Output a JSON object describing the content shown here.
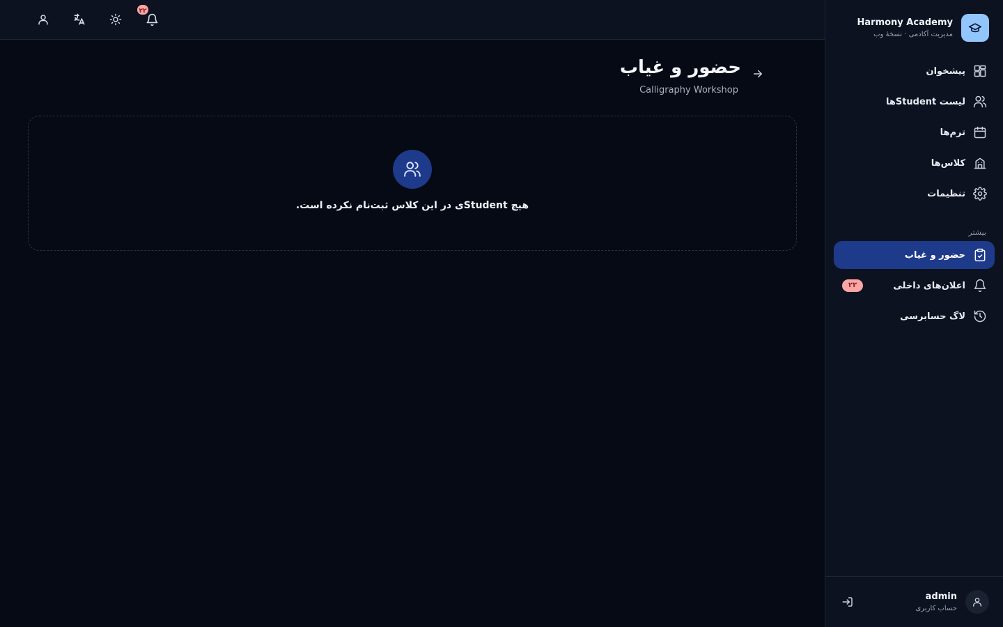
{
  "brand": {
    "name": "Harmony Academy",
    "subtitle": "مدیریت آکادمی · نسخهٔ وب",
    "logo_icon": "graduation-cap-icon"
  },
  "nav": {
    "main_items": [
      {
        "label": "پیشخوان",
        "icon": "dashboard-icon"
      },
      {
        "label": "لیست Studentها",
        "icon": "users-icon"
      },
      {
        "label": "ترم‌ها",
        "icon": "calendar-icon"
      },
      {
        "label": "کلاس‌ها",
        "icon": "school-icon"
      },
      {
        "label": "تنظیمات",
        "icon": "gear-icon"
      }
    ],
    "section_title": "بیشتر",
    "more_items": [
      {
        "label": "حضور و غیاب",
        "icon": "clipboard-icon",
        "active": true
      },
      {
        "label": "اعلان‌های داخلی",
        "icon": "bell-icon",
        "badge": "۲۲"
      },
      {
        "label": "لاگ حسابرسی",
        "icon": "history-icon"
      }
    ]
  },
  "user": {
    "name": "admin",
    "role": "حساب کاربری"
  },
  "topbar": {
    "notifications_badge": "۲۲"
  },
  "page": {
    "title": "حضور و غیاب",
    "subtitle": "Calligraphy Workshop",
    "empty_message": "هیچ Studentی در این کلاس ثبت‌نام نکرده است."
  },
  "colors": {
    "background": "#060a14",
    "panel": "#0c1220",
    "accent": "#1e3a8a",
    "badge": "#fca5a5",
    "logo": "#93c5fd"
  }
}
